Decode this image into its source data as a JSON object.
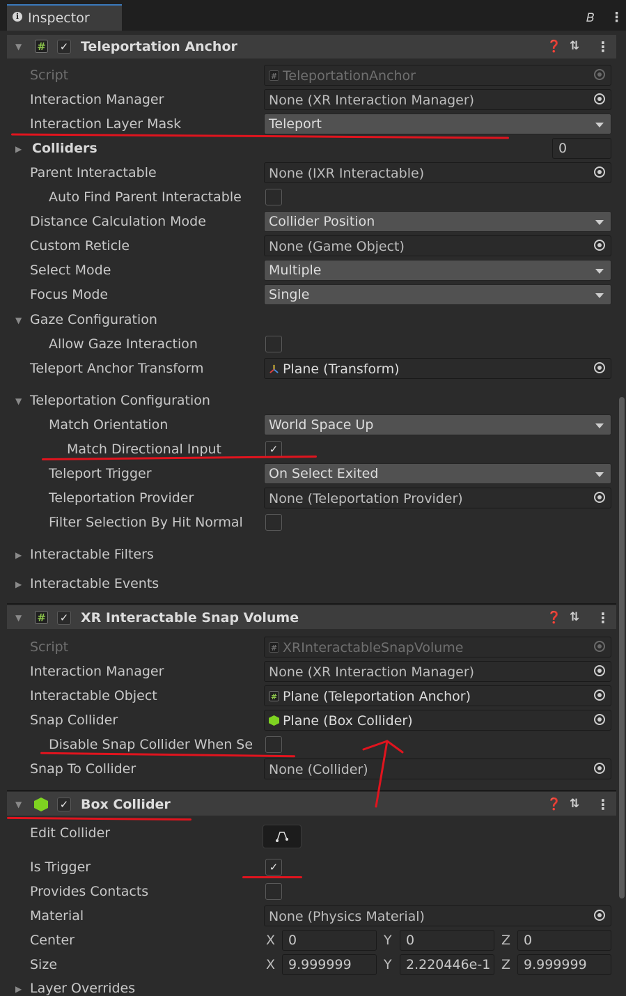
{
  "tab": {
    "label": "Inspector"
  },
  "teleportation_anchor": {
    "title": "Teleportation Anchor",
    "script_label": "Script",
    "script_value": "TeleportationAnchor",
    "interaction_manager_label": "Interaction Manager",
    "interaction_manager_value": "None (XR Interaction Manager)",
    "interaction_layer_mask_label": "Interaction Layer Mask",
    "interaction_layer_mask_value": "Teleport",
    "colliders_label": "Colliders",
    "colliders_count": "0",
    "parent_interactable_label": "Parent Interactable",
    "parent_interactable_value": "None (IXR Interactable)",
    "auto_find_label": "Auto Find Parent Interactable",
    "distance_mode_label": "Distance Calculation Mode",
    "distance_mode_value": "Collider Position",
    "custom_reticle_label": "Custom Reticle",
    "custom_reticle_value": "None (Game Object)",
    "select_mode_label": "Select Mode",
    "select_mode_value": "Multiple",
    "focus_mode_label": "Focus Mode",
    "focus_mode_value": "Single",
    "gaze_config_label": "Gaze Configuration",
    "allow_gaze_label": "Allow Gaze Interaction",
    "anchor_transform_label": "Teleport Anchor Transform",
    "anchor_transform_value": "Plane (Transform)",
    "teleport_config_label": "Teleportation Configuration",
    "match_orientation_label": "Match Orientation",
    "match_orientation_value": "World Space Up",
    "match_directional_label": "Match Directional Input",
    "teleport_trigger_label": "Teleport Trigger",
    "teleport_trigger_value": "On Select Exited",
    "teleport_provider_label": "Teleportation Provider",
    "teleport_provider_value": "None (Teleportation Provider)",
    "filter_hit_normal_label": "Filter Selection By Hit Normal",
    "interactable_filters_label": "Interactable Filters",
    "interactable_events_label": "Interactable Events"
  },
  "snap_volume": {
    "title": "XR Interactable Snap Volume",
    "script_label": "Script",
    "script_value": "XRInteractableSnapVolume",
    "interaction_manager_label": "Interaction Manager",
    "interaction_manager_value": "None (XR Interaction Manager)",
    "interactable_object_label": "Interactable Object",
    "interactable_object_value": "Plane (Teleportation Anchor)",
    "snap_collider_label": "Snap Collider",
    "snap_collider_value": "Plane (Box Collider)",
    "disable_snap_label": "Disable Snap Collider When Se",
    "snap_to_collider_label": "Snap To Collider",
    "snap_to_collider_value": "None (Collider)"
  },
  "box_collider": {
    "title": "Box Collider",
    "edit_collider_label": "Edit Collider",
    "is_trigger_label": "Is Trigger",
    "provides_contacts_label": "Provides Contacts",
    "material_label": "Material",
    "material_value": "None (Physics Material)",
    "center_label": "Center",
    "center": {
      "x": "0",
      "y": "0",
      "z": "0"
    },
    "size_label": "Size",
    "size": {
      "x": "9.999999",
      "y": "2.220446e-1",
      "z": "9.999999"
    },
    "layer_overrides_label": "Layer Overrides"
  },
  "axes": {
    "x": "X",
    "y": "Y",
    "z": "Z"
  },
  "colors": {
    "annotation_red": "#e0141e",
    "accent_blue": "#3a79bb"
  }
}
